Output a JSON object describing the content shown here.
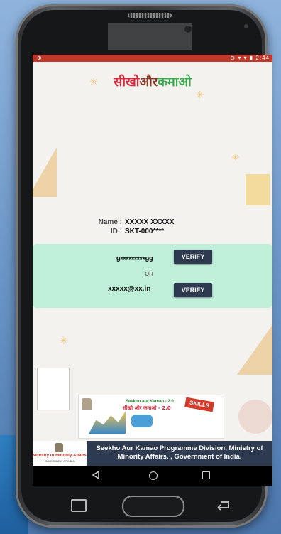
{
  "status_bar": {
    "left": "⊕",
    "right": "⊙ ▾ ▾ ▮ 2:44"
  },
  "logo": {
    "part1": "सीखो",
    "part2": "और",
    "part3": "कमाओ"
  },
  "profile": {
    "name_label": "Name :",
    "name_value": "XXXXX XXXXX",
    "id_label": "ID :",
    "id_value": "SKT-000****"
  },
  "verify": {
    "phone": "9*********99",
    "or_text": "OR",
    "email": "xxxxx@xx.in",
    "phone_button": "VERIFY",
    "email_button": "VERIFY"
  },
  "banner": {
    "line1": "Seekho aur Kamao - 2.0",
    "line2": "सीखो और कमाओ - 2.0",
    "skills_tag": "SKILLS"
  },
  "footer": {
    "logo_title": "Ministry of Minority Affairs",
    "logo_subtitle": "GOVERNMENT OF INDIA",
    "text": "Seekho Aur Kamao Programme Division, Ministry of Minority Affairs. , Government of India."
  },
  "colors": {
    "accent_dark": "#2e3a4f",
    "panel": "#bfefd9",
    "status_bar": "#c0392b"
  }
}
